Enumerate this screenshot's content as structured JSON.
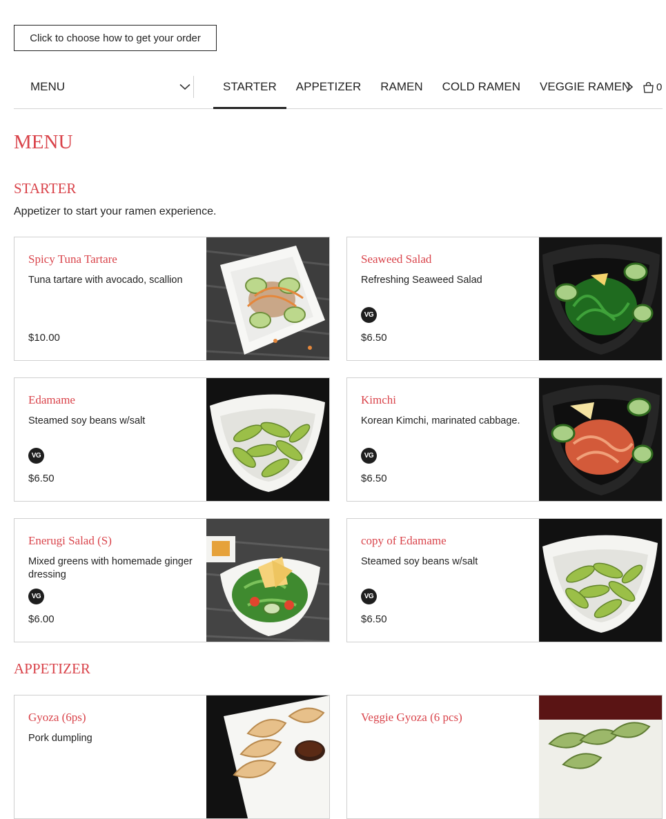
{
  "order_button": {
    "label": "Click to choose how to get your order"
  },
  "nav": {
    "menu_select": {
      "label": "MENU"
    },
    "tabs": [
      {
        "label": "STARTER",
        "active": true
      },
      {
        "label": "APPETIZER",
        "active": false
      },
      {
        "label": "RAMEN",
        "active": false
      },
      {
        "label": "COLD RAMEN",
        "active": false
      },
      {
        "label": "VEGGIE RAMEN",
        "active": false
      }
    ],
    "cart_count": "0"
  },
  "page_title": "MENU",
  "sections": [
    {
      "title": "STARTER",
      "description": "Appetizer to start your ramen experience.",
      "items": [
        {
          "name": "Spicy Tuna Tartare",
          "description": "Tuna tartare with avocado, scallion",
          "badge": "",
          "price": "$10.00",
          "image_icon": "tuna-tartare-photo"
        },
        {
          "name": "Seaweed Salad",
          "description": "Refreshing Seaweed Salad",
          "badge": "VG",
          "price": "$6.50",
          "image_icon": "seaweed-salad-photo"
        },
        {
          "name": "Edamame",
          "description": "Steamed soy beans w/salt",
          "badge": "VG",
          "price": "$6.50",
          "image_icon": "edamame-photo"
        },
        {
          "name": "Kimchi",
          "description": "Korean Kimchi, marinated cabbage.",
          "badge": "VG",
          "price": "$6.50",
          "image_icon": "kimchi-photo"
        },
        {
          "name": "Enerugi Salad (S)",
          "description": "Mixed greens with homemade ginger dressing",
          "badge": "VG",
          "price": "$6.00",
          "image_icon": "salad-photo"
        },
        {
          "name": "copy of Edamame",
          "description": "Steamed soy beans w/salt",
          "badge": "VG",
          "price": "$6.50",
          "image_icon": "edamame-photo"
        }
      ]
    },
    {
      "title": "APPETIZER",
      "items": [
        {
          "name": "Gyoza (6ps)",
          "description": "Pork dumpling",
          "image_icon": "gyoza-photo"
        },
        {
          "name": "Veggie Gyoza (6 pcs)",
          "description": "",
          "image_icon": "veggie-gyoza-photo"
        }
      ]
    }
  ],
  "colors": {
    "accent": "#d9434a",
    "text": "#222222",
    "border": "#cfcfcf",
    "badge_bg": "#1e1e1e"
  }
}
